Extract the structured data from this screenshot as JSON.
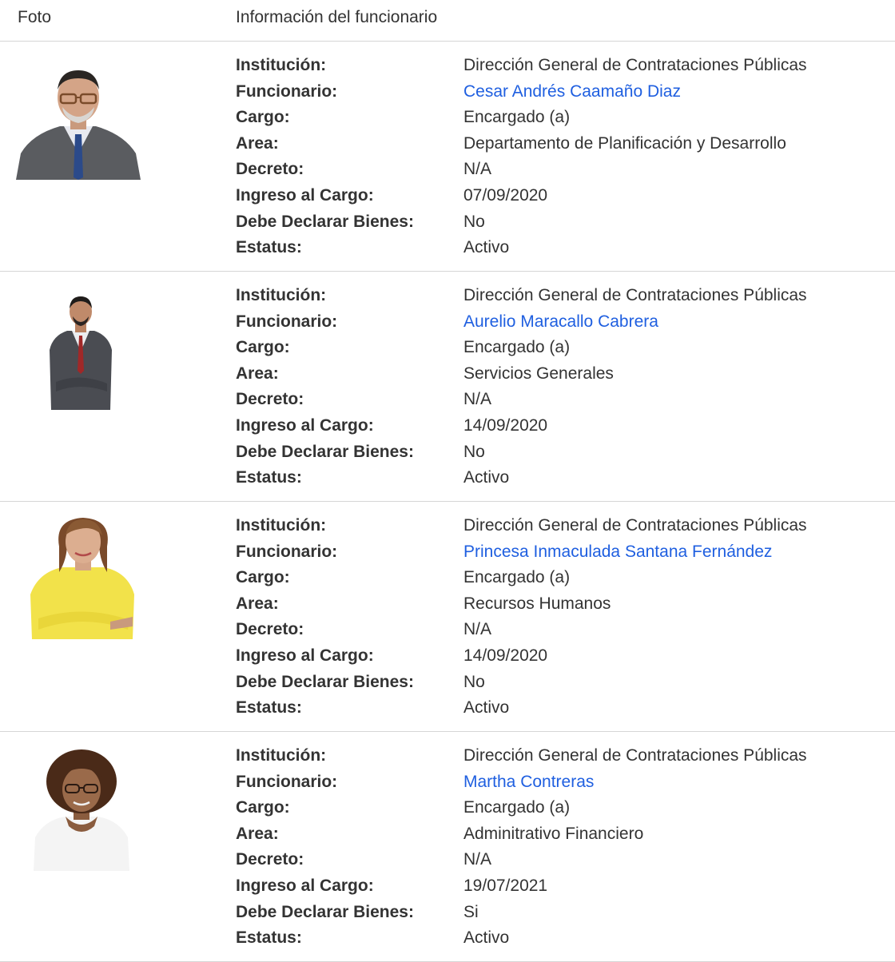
{
  "header": {
    "foto_label": "Foto",
    "info_label": "Información del funcionario"
  },
  "labels": {
    "institucion": "Institución:",
    "funcionario": "Funcionario:",
    "cargo": "Cargo:",
    "area": "Area:",
    "decreto": "Decreto:",
    "ingreso": "Ingreso al Cargo:",
    "declarar": "Debe Declarar Bienes:",
    "estatus": "Estatus:"
  },
  "officials": [
    {
      "institucion": "Dirección General de Contrataciones Públicas",
      "funcionario": "Cesar Andrés Caamaño Diaz",
      "cargo": "Encargado (a)",
      "area": "Departamento de Planificación y Desarrollo",
      "decreto": "N/A",
      "ingreso": "07/09/2020",
      "declarar": "No",
      "estatus": "Activo"
    },
    {
      "institucion": "Dirección General de Contrataciones Públicas",
      "funcionario": "Aurelio Maracallo Cabrera",
      "cargo": "Encargado (a)",
      "area": "Servicios Generales",
      "decreto": "N/A",
      "ingreso": "14/09/2020",
      "declarar": "No",
      "estatus": "Activo"
    },
    {
      "institucion": "Dirección General de Contrataciones Públicas",
      "funcionario": "Princesa Inmaculada Santana Fernández",
      "cargo": "Encargado (a)",
      "area": "Recursos Humanos",
      "decreto": "N/A",
      "ingreso": "14/09/2020",
      "declarar": "No",
      "estatus": "Activo"
    },
    {
      "institucion": "Dirección General de Contrataciones Públicas",
      "funcionario": "Martha Contreras",
      "cargo": "Encargado (a)",
      "area": "Adminitrativo Financiero",
      "decreto": "N/A",
      "ingreso": "19/07/2021",
      "declarar": "Si",
      "estatus": "Activo"
    }
  ],
  "colors": {
    "link": "#1f5fe0",
    "text": "#333333",
    "divider": "#d6d6d6"
  }
}
